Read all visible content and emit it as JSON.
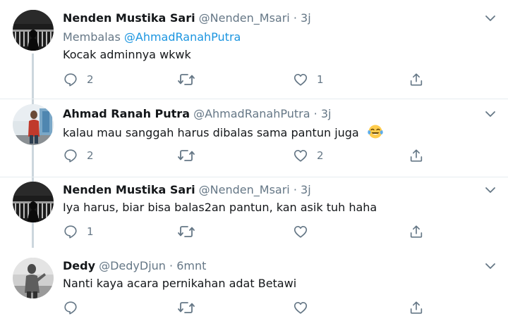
{
  "tweets": [
    {
      "name": "Nenden Mustika Sari",
      "handle": "@Nenden_Msari",
      "separator": "·",
      "time": "3j",
      "reply_prefix": "Membalas",
      "reply_mention": "@AhmadRanahPutra",
      "text": "Kocak adminnya wkwk",
      "replies": "2",
      "retweets": "",
      "likes": "1"
    },
    {
      "name": "Ahmad Ranah Putra",
      "handle": "@AhmadRanahPutra",
      "separator": "·",
      "time": "3j",
      "text": "kalau mau sanggah harus dibalas sama pantun juga",
      "replies": "2",
      "retweets": "",
      "likes": "2"
    },
    {
      "name": "Nenden Mustika Sari",
      "handle": "@Nenden_Msari",
      "separator": "·",
      "time": "3j",
      "text": "Iya harus, biar bisa balas2an pantun, kan asik tuh haha",
      "replies": "1",
      "retweets": "",
      "likes": ""
    },
    {
      "name": "Dedy",
      "handle": "@DedyDjun",
      "separator": "·",
      "time": "6mnt",
      "text": "Nanti kaya acara pernikahan adat Betawi",
      "replies": "",
      "retweets": "",
      "likes": ""
    }
  ],
  "icons": {
    "reply": "reply-icon",
    "retweet": "retweet-icon",
    "like": "heart-icon",
    "share": "share-icon",
    "more": "chevron-down-icon",
    "emoji": "face-with-tears-of-joy-emoji"
  },
  "colors": {
    "name": "#14171a",
    "secondary": "#657786",
    "link": "#1b95e0",
    "divider": "#e6ecf0",
    "thread_line": "#ccd6dd"
  }
}
